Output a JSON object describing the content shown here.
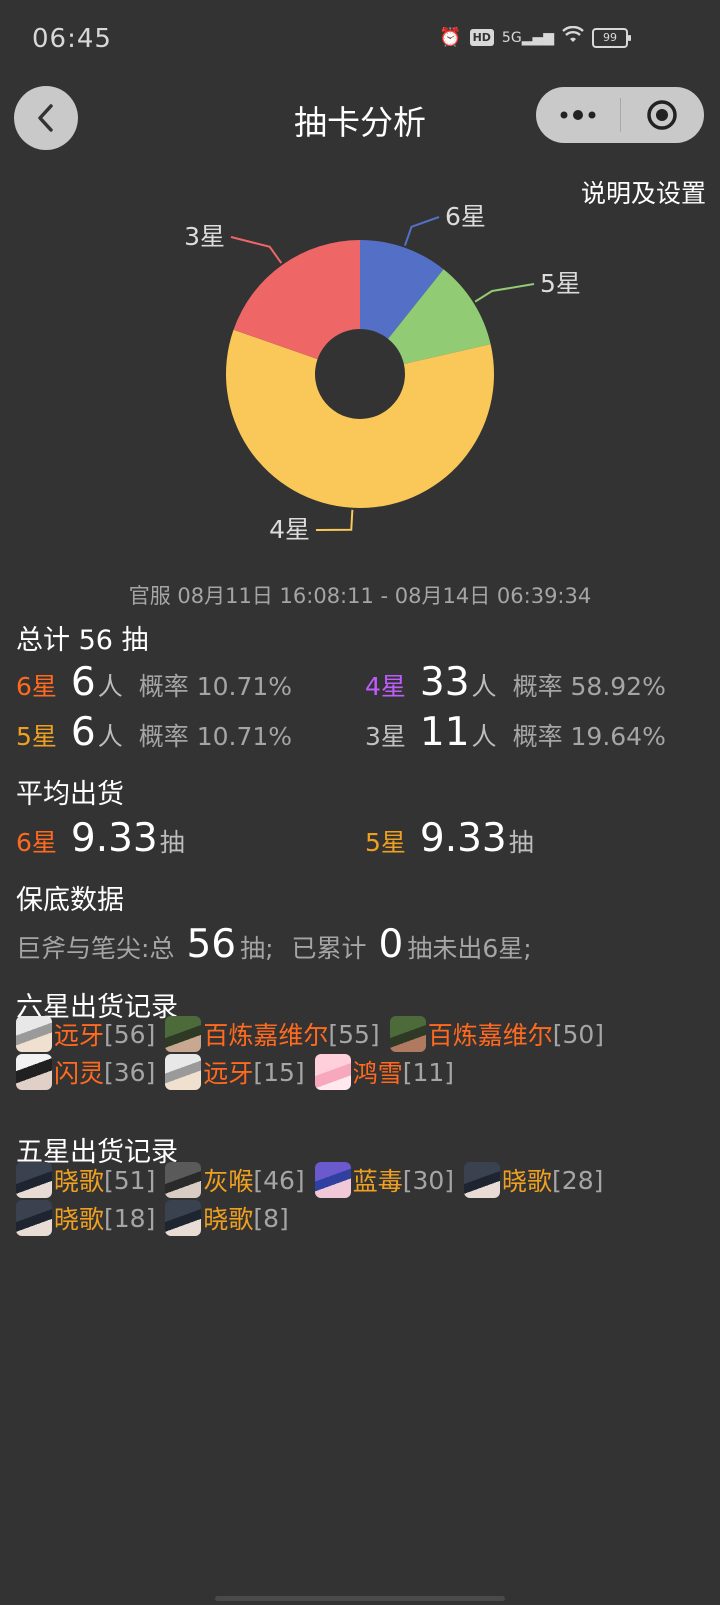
{
  "status_bar": {
    "time": "06:45",
    "icons": [
      "alarm-icon",
      "hd-icon",
      "signal-5g-icon",
      "wifi-icon",
      "battery-icon"
    ],
    "hd_label": "HD",
    "network_label": "5G",
    "battery_level": "99"
  },
  "nav": {
    "title": "抽卡分析",
    "back_icon": "chevron-left-icon",
    "more_icon": "more-dots-icon",
    "close_icon": "target-icon"
  },
  "settings_link": "说明及设置",
  "chart_data": {
    "type": "pie",
    "donut": true,
    "categories": [
      "6星",
      "5星",
      "4星",
      "3星"
    ],
    "values": [
      6,
      6,
      33,
      11
    ],
    "colors": [
      "#5470c6",
      "#91cc75",
      "#fac858",
      "#ee6666"
    ],
    "labels": [
      "6星",
      "5星",
      "4星",
      "3星"
    ]
  },
  "date_range": "官服 08月11日 16:08:11 - 08月14日 06:39:34",
  "summary": {
    "total_label": "总计 56 抽",
    "stats": [
      {
        "star": "6星",
        "count": "6",
        "unit": "人",
        "prob": "概率 10.71%",
        "color": "#ff6a1f"
      },
      {
        "star": "4星",
        "count": "33",
        "unit": "人",
        "prob": "概率 58.92%",
        "color": "#c05cff"
      },
      {
        "star": "5星",
        "count": "6",
        "unit": "人",
        "prob": "概率 10.71%",
        "color": "#f0a020"
      },
      {
        "star": "3星",
        "count": "11",
        "unit": "人",
        "prob": "概率 19.64%",
        "color": "#c0c0c0"
      }
    ]
  },
  "average": {
    "title": "平均出货",
    "items": [
      {
        "star": "6星",
        "value": "9.33",
        "unit": "抽"
      },
      {
        "star": "5星",
        "value": "9.33",
        "unit": "抽"
      }
    ]
  },
  "pity": {
    "title": "保底数据",
    "pool_label": "巨斧与笔尖:总",
    "total": "56",
    "unit": "抽;",
    "accumulated_label": "已累计",
    "accumulated": "0",
    "suffix": "抽未出6星;"
  },
  "six_star_records": {
    "title": "六星出货记录",
    "lines": [
      [
        {
          "name": "远牙",
          "count": "[56]"
        },
        {
          "name": "百炼嘉维尔",
          "count": "[55]"
        },
        {
          "name": "百炼嘉维尔",
          "count": "[50]"
        }
      ],
      [
        {
          "name": "闪灵",
          "count": "[36]"
        },
        {
          "name": "远牙",
          "count": "[15]"
        },
        {
          "name": "鸿雪",
          "count": "[11]"
        }
      ]
    ]
  },
  "five_star_records": {
    "title": "五星出货记录",
    "lines": [
      [
        {
          "name": "晓歌",
          "count": "[51]"
        },
        {
          "name": "灰喉",
          "count": "[46]"
        },
        {
          "name": "蓝毒",
          "count": "[30]"
        },
        {
          "name": "晓歌",
          "count": "[28]"
        }
      ],
      [
        {
          "name": "晓歌",
          "count": "[18]"
        },
        {
          "name": "晓歌",
          "count": "[8]"
        }
      ]
    ]
  }
}
